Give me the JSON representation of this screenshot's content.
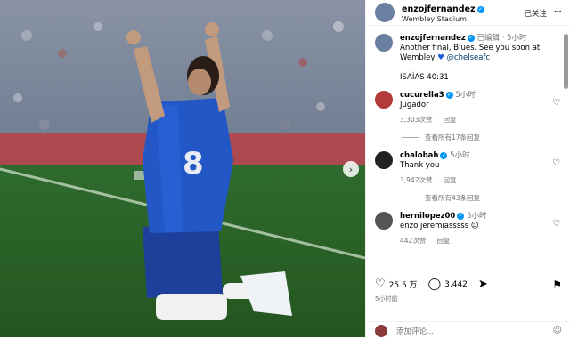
{
  "header": {
    "username": "enzojfernandez",
    "location": "Wembley Stadium",
    "follow_label": "已关注",
    "more_icon": "..."
  },
  "caption": {
    "username": "enzojfernandez",
    "edited": "已编辑",
    "time": "5小时",
    "text_line1": "Another final, Blues. See you soon at",
    "text_line2": "Wembley",
    "mention": "@chelseafc",
    "verse": "ISAÍAS 40:31"
  },
  "comments": [
    {
      "username": "cucurella3",
      "time": "5小时",
      "text": "Jugador",
      "likes": "3,303次赞",
      "reply": "回复",
      "view_replies": "查看所有17条回复"
    },
    {
      "username": "chalobah",
      "time": "5小时",
      "text": "Thank you",
      "likes": "3,942次赞",
      "reply": "回复",
      "view_replies": "查看所有43条回复"
    },
    {
      "username": "hernilopez00",
      "time": "5小时",
      "text": "enzo jeremiasssss",
      "likes": "442次赞",
      "reply": "回复"
    }
  ],
  "footer": {
    "likes": "25.5 万",
    "comments": "3,442",
    "time": "5小时前",
    "add_comment_placeholder": "添加评论..."
  },
  "colors": {
    "verified": "#0095f6",
    "mention": "#00376b",
    "muted": "#737373"
  }
}
